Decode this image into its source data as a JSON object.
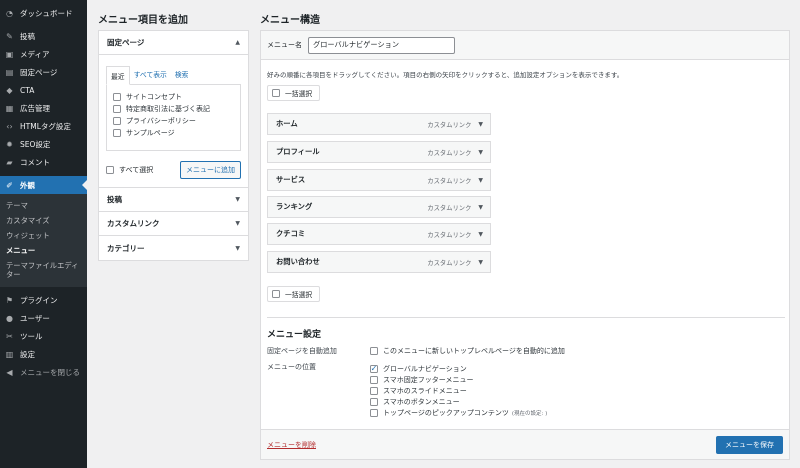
{
  "sidebar": {
    "items_top": [
      {
        "label": "ダッシュボード",
        "icon": "dashboard-icon"
      }
    ],
    "items_mid": [
      {
        "label": "投稿",
        "icon": "pin-icon"
      },
      {
        "label": "メディア",
        "icon": "media-icon"
      },
      {
        "label": "固定ページ",
        "icon": "page-icon"
      },
      {
        "label": "CTA",
        "icon": "diamond-icon"
      },
      {
        "label": "広告管理",
        "icon": "ad-icon"
      },
      {
        "label": "HTMLタグ設定",
        "icon": "code-icon"
      },
      {
        "label": "SEO設定",
        "icon": "gear-icon"
      },
      {
        "label": "コメント",
        "icon": "comment-icon"
      }
    ],
    "active": {
      "label": "外観",
      "icon": "brush-icon"
    },
    "submenu": [
      "テーマ",
      "カスタマイズ",
      "ウィジェット",
      "メニュー",
      "テーマファイルエディター"
    ],
    "submenu_current": "メニュー",
    "items_bottom": [
      {
        "label": "プラグイン",
        "icon": "plugin-icon"
      },
      {
        "label": "ユーザー",
        "icon": "user-icon"
      },
      {
        "label": "ツール",
        "icon": "wrench-icon"
      },
      {
        "label": "設定",
        "icon": "settings-icon"
      }
    ],
    "close_label": "メニューを閉じる"
  },
  "add_items": {
    "heading": "メニュー項目を追加",
    "pages_section": {
      "title": "固定ページ",
      "tabs": [
        "最近",
        "すべて表示",
        "検索"
      ],
      "pages": [
        "サイトコンセプト",
        "特定商取引法に基づく表記",
        "プライバシーポリシー",
        "サンプルページ"
      ],
      "select_all": "すべて選択",
      "add_button": "メニューに追加"
    },
    "other_sections": [
      "投稿",
      "カスタムリンク",
      "カテゴリー"
    ]
  },
  "structure": {
    "heading": "メニュー構造",
    "name_label": "メニュー名",
    "name_value": "グローバルナビゲーション",
    "instructions": "好みの順番に各項目をドラッグしてください。項目の右側の矢印をクリックすると、追加設定オプションを表示できます。",
    "bulk_select": "一括選択",
    "item_type": "カスタムリンク",
    "items": [
      "ホーム",
      "プロフィール",
      "サービス",
      "ランキング",
      "クチコミ",
      "お問い合わせ"
    ]
  },
  "settings": {
    "title": "メニュー設定",
    "auto_add_label": "固定ページを自動追加",
    "auto_add_option": "このメニューに新しいトップレベルページを自動的に追加",
    "location_label": "メニューの位置",
    "locations": [
      {
        "label": "グローバルナビゲーション",
        "checked": true,
        "note": ""
      },
      {
        "label": "スマホ固定フッターメニュー",
        "checked": false,
        "note": ""
      },
      {
        "label": "スマホのスライドメニュー",
        "checked": false,
        "note": ""
      },
      {
        "label": "スマホのボタンメニュー",
        "checked": false,
        "note": ""
      },
      {
        "label": "トップページのピックアップコンテンツ",
        "checked": false,
        "note": "(現在の設定: )"
      }
    ]
  },
  "footer": {
    "delete_label": "メニューを削除",
    "save_label": "メニューを保存"
  },
  "colors": {
    "accent": "#2271b1",
    "sidebar": "#1d2327",
    "danger": "#b32d2e"
  }
}
